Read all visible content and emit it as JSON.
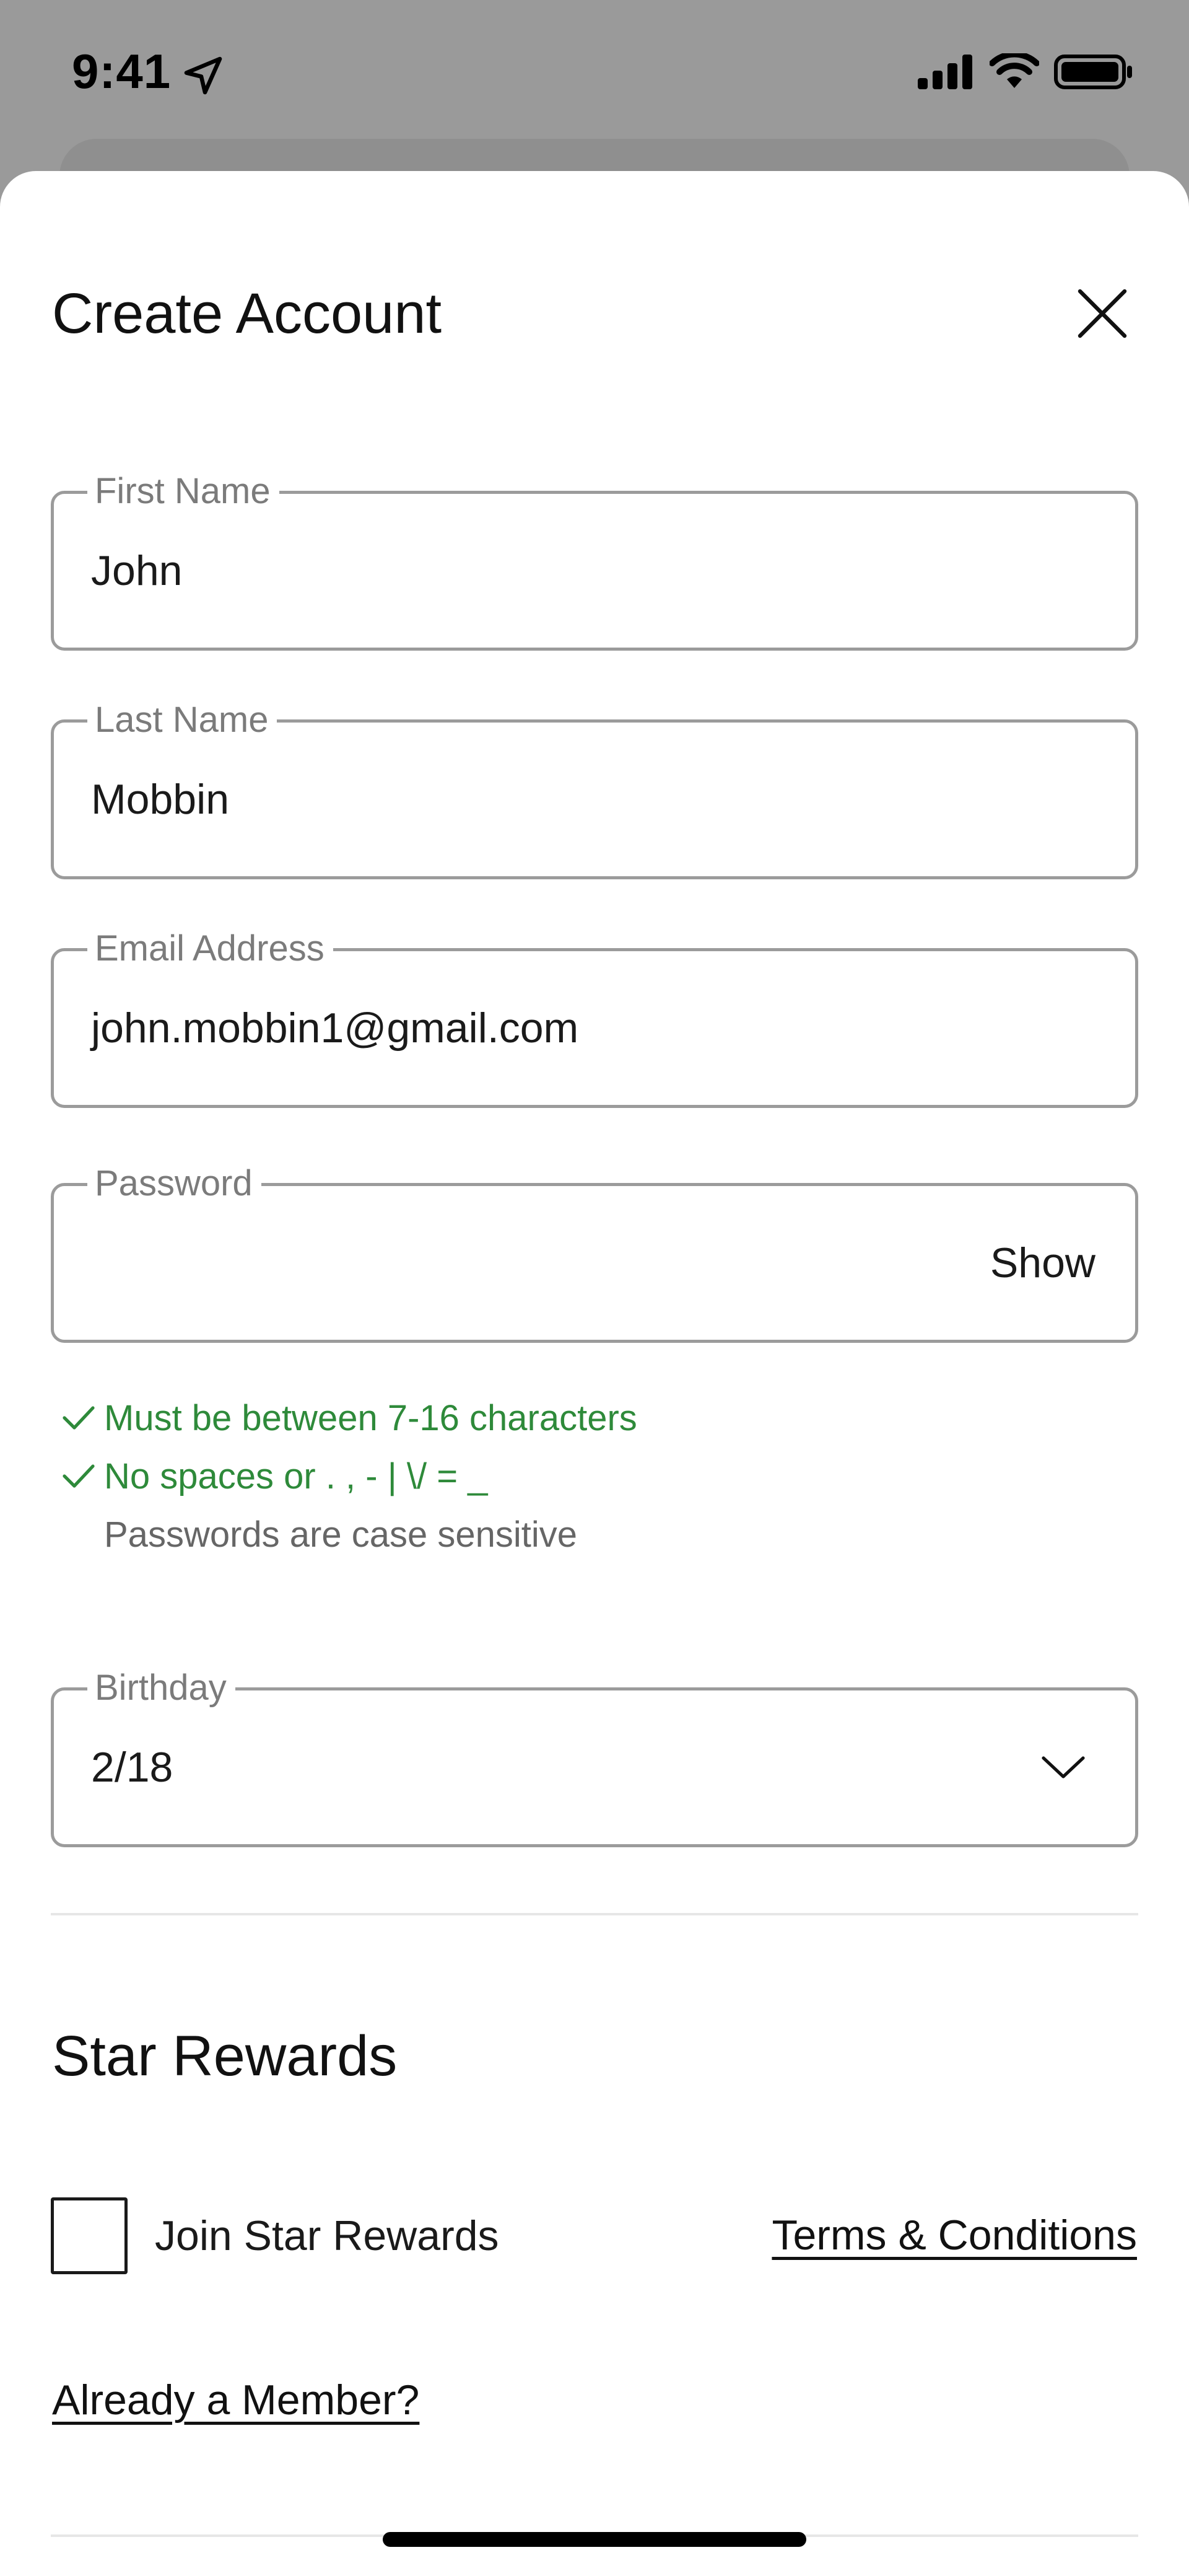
{
  "status_bar": {
    "time": "9:41"
  },
  "sheet": {
    "title": "Create Account"
  },
  "fields": {
    "first_name": {
      "label": "First Name",
      "value": "John"
    },
    "last_name": {
      "label": "Last Name",
      "value": "Mobbin"
    },
    "email": {
      "label": "Email Address",
      "value": "john.mobbin1@gmail.com"
    },
    "password": {
      "label": "Password",
      "value": "",
      "toggle_label": "Show"
    },
    "birthday": {
      "label": "Birthday",
      "value": "2/18"
    }
  },
  "password_rules": [
    {
      "text": "Must be between 7-16 characters",
      "satisfied": true
    },
    {
      "text": "No spaces or . , - | \\/ = _",
      "satisfied": true
    },
    {
      "text": "Passwords are case sensitive",
      "satisfied": false
    }
  ],
  "rewards": {
    "title": "Star Rewards",
    "join_label": "Join Star Rewards",
    "join_checked": false,
    "terms_link": "Terms & Conditions",
    "member_link": "Already a Member?"
  },
  "colors": {
    "success": "#2e8a3a",
    "border": "#9b9b9b",
    "label": "#7b7b7b"
  },
  "icons": {
    "close": "close-icon",
    "check": "check-icon",
    "chevron": "chevron-down-icon",
    "signal": "cellular-signal-icon",
    "wifi": "wifi-icon",
    "battery": "battery-icon",
    "location": "location-arrow-icon"
  }
}
